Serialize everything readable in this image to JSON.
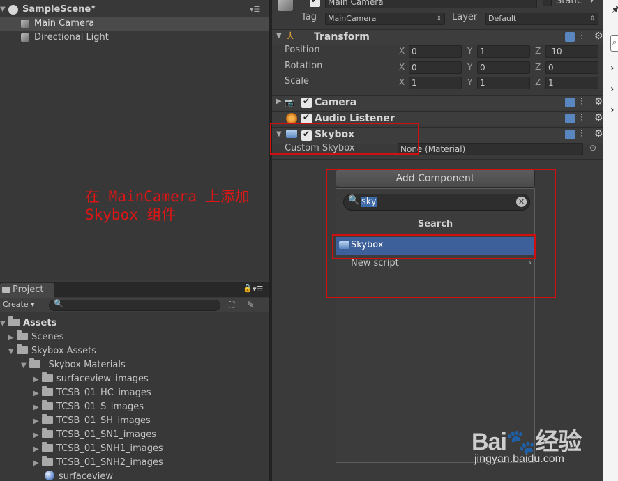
{
  "hierarchy": {
    "scene": "SampleScene*",
    "items": [
      "Main Camera",
      "Directional Light"
    ]
  },
  "project": {
    "tab": "Project",
    "create": "Create",
    "tree": [
      {
        "label": "Assets",
        "expanded": true
      },
      {
        "label": "Scenes",
        "expanded": false
      },
      {
        "label": "Skybox Assets",
        "expanded": true
      },
      {
        "label": "_Skybox Materials",
        "expanded": true
      },
      {
        "label": "surfaceview_images",
        "expanded": false
      },
      {
        "label": "TCSB_01_HC_images",
        "expanded": false
      },
      {
        "label": "TCSB_01_S_images",
        "expanded": false
      },
      {
        "label": "TCSB_01_SH_images",
        "expanded": false
      },
      {
        "label": "TCSB_01_SN1_images",
        "expanded": false
      },
      {
        "label": "TCSB_01_SNH1_images",
        "expanded": false
      },
      {
        "label": "TCSB_01_SNH2_images",
        "expanded": false
      },
      {
        "label": "surfaceview"
      }
    ]
  },
  "inspector": {
    "object_name": "Main Camera",
    "static_label": "Static",
    "tag_label": "Tag",
    "tag_value": "MainCamera",
    "layer_label": "Layer",
    "layer_value": "Default",
    "transform": {
      "title": "Transform",
      "position_label": "Position",
      "rotation_label": "Rotation",
      "scale_label": "Scale",
      "axes": [
        "X",
        "Y",
        "Z"
      ],
      "position": [
        "0",
        "1",
        "-10"
      ],
      "rotation": [
        "0",
        "0",
        "0"
      ],
      "scale": [
        "1",
        "1",
        "1"
      ]
    },
    "camera_title": "Camera",
    "audio_title": "Audio Listener",
    "skybox": {
      "title": "Skybox",
      "field_label": "Custom Skybox",
      "field_value": "None (Material)"
    }
  },
  "add_component": {
    "button": "Add Component",
    "search_value": "sky",
    "section": "Search",
    "results": [
      "Skybox",
      "New script"
    ]
  },
  "annotation": {
    "line1": "在 MainCamera 上添加",
    "line2": "Skybox 组件"
  },
  "watermark": {
    "line2": "jingyan.baidu.com"
  },
  "colors": {
    "selected_row": "#3d5f9a",
    "annotation_red": "#e01515"
  }
}
